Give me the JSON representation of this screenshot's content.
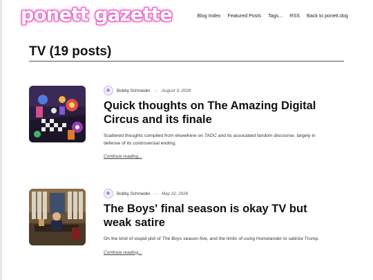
{
  "header": {
    "logo_text": "ponett gazette",
    "nav": [
      {
        "label": "Blog Index"
      },
      {
        "label": "Featured Posts"
      },
      {
        "label": "Tags..."
      },
      {
        "label": "RSS"
      },
      {
        "label": "Back to ponett.dog"
      }
    ]
  },
  "page": {
    "title": "TV (19 posts)"
  },
  "posts": [
    {
      "author": "Bobby Schroeder",
      "separator": "—",
      "date": "August 3, 2026",
      "title": "Quick thoughts on The Amazing Digital Circus and its finale",
      "excerpt_before": "Scattered thoughts compiled from elsewhere on ",
      "excerpt_em": "TADC",
      "excerpt_after": " and its associated fandom discourse, largely in defense of its controversial ending.",
      "continue": "Continue reading..."
    },
    {
      "author": "Bobby Schroeder",
      "separator": "—",
      "date": "May 22, 2026",
      "title": "The Boys' final season is okay TV but weak satire",
      "excerpt_before": "On the kind of stupid plot of ",
      "excerpt_em": "The Boys",
      "excerpt_after": " season five, and the limits of using Homelander to satirize Trump.",
      "continue": "Continue reading..."
    }
  ],
  "colors": {
    "logo_glow": "#e85fc3",
    "text": "#1a1a1a",
    "rule": "#555555"
  }
}
